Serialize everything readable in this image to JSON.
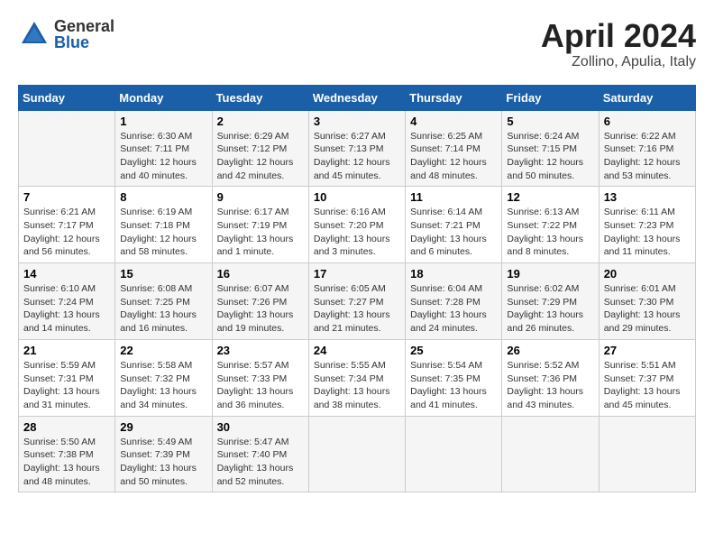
{
  "header": {
    "logo_general": "General",
    "logo_blue": "Blue",
    "month_title": "April 2024",
    "location": "Zollino, Apulia, Italy"
  },
  "weekdays": [
    "Sunday",
    "Monday",
    "Tuesday",
    "Wednesday",
    "Thursday",
    "Friday",
    "Saturday"
  ],
  "weeks": [
    [
      {
        "day": "",
        "info": ""
      },
      {
        "day": "1",
        "info": "Sunrise: 6:30 AM\nSunset: 7:11 PM\nDaylight: 12 hours\nand 40 minutes."
      },
      {
        "day": "2",
        "info": "Sunrise: 6:29 AM\nSunset: 7:12 PM\nDaylight: 12 hours\nand 42 minutes."
      },
      {
        "day": "3",
        "info": "Sunrise: 6:27 AM\nSunset: 7:13 PM\nDaylight: 12 hours\nand 45 minutes."
      },
      {
        "day": "4",
        "info": "Sunrise: 6:25 AM\nSunset: 7:14 PM\nDaylight: 12 hours\nand 48 minutes."
      },
      {
        "day": "5",
        "info": "Sunrise: 6:24 AM\nSunset: 7:15 PM\nDaylight: 12 hours\nand 50 minutes."
      },
      {
        "day": "6",
        "info": "Sunrise: 6:22 AM\nSunset: 7:16 PM\nDaylight: 12 hours\nand 53 minutes."
      }
    ],
    [
      {
        "day": "7",
        "info": "Sunrise: 6:21 AM\nSunset: 7:17 PM\nDaylight: 12 hours\nand 56 minutes."
      },
      {
        "day": "8",
        "info": "Sunrise: 6:19 AM\nSunset: 7:18 PM\nDaylight: 12 hours\nand 58 minutes."
      },
      {
        "day": "9",
        "info": "Sunrise: 6:17 AM\nSunset: 7:19 PM\nDaylight: 13 hours\nand 1 minute."
      },
      {
        "day": "10",
        "info": "Sunrise: 6:16 AM\nSunset: 7:20 PM\nDaylight: 13 hours\nand 3 minutes."
      },
      {
        "day": "11",
        "info": "Sunrise: 6:14 AM\nSunset: 7:21 PM\nDaylight: 13 hours\nand 6 minutes."
      },
      {
        "day": "12",
        "info": "Sunrise: 6:13 AM\nSunset: 7:22 PM\nDaylight: 13 hours\nand 8 minutes."
      },
      {
        "day": "13",
        "info": "Sunrise: 6:11 AM\nSunset: 7:23 PM\nDaylight: 13 hours\nand 11 minutes."
      }
    ],
    [
      {
        "day": "14",
        "info": "Sunrise: 6:10 AM\nSunset: 7:24 PM\nDaylight: 13 hours\nand 14 minutes."
      },
      {
        "day": "15",
        "info": "Sunrise: 6:08 AM\nSunset: 7:25 PM\nDaylight: 13 hours\nand 16 minutes."
      },
      {
        "day": "16",
        "info": "Sunrise: 6:07 AM\nSunset: 7:26 PM\nDaylight: 13 hours\nand 19 minutes."
      },
      {
        "day": "17",
        "info": "Sunrise: 6:05 AM\nSunset: 7:27 PM\nDaylight: 13 hours\nand 21 minutes."
      },
      {
        "day": "18",
        "info": "Sunrise: 6:04 AM\nSunset: 7:28 PM\nDaylight: 13 hours\nand 24 minutes."
      },
      {
        "day": "19",
        "info": "Sunrise: 6:02 AM\nSunset: 7:29 PM\nDaylight: 13 hours\nand 26 minutes."
      },
      {
        "day": "20",
        "info": "Sunrise: 6:01 AM\nSunset: 7:30 PM\nDaylight: 13 hours\nand 29 minutes."
      }
    ],
    [
      {
        "day": "21",
        "info": "Sunrise: 5:59 AM\nSunset: 7:31 PM\nDaylight: 13 hours\nand 31 minutes."
      },
      {
        "day": "22",
        "info": "Sunrise: 5:58 AM\nSunset: 7:32 PM\nDaylight: 13 hours\nand 34 minutes."
      },
      {
        "day": "23",
        "info": "Sunrise: 5:57 AM\nSunset: 7:33 PM\nDaylight: 13 hours\nand 36 minutes."
      },
      {
        "day": "24",
        "info": "Sunrise: 5:55 AM\nSunset: 7:34 PM\nDaylight: 13 hours\nand 38 minutes."
      },
      {
        "day": "25",
        "info": "Sunrise: 5:54 AM\nSunset: 7:35 PM\nDaylight: 13 hours\nand 41 minutes."
      },
      {
        "day": "26",
        "info": "Sunrise: 5:52 AM\nSunset: 7:36 PM\nDaylight: 13 hours\nand 43 minutes."
      },
      {
        "day": "27",
        "info": "Sunrise: 5:51 AM\nSunset: 7:37 PM\nDaylight: 13 hours\nand 45 minutes."
      }
    ],
    [
      {
        "day": "28",
        "info": "Sunrise: 5:50 AM\nSunset: 7:38 PM\nDaylight: 13 hours\nand 48 minutes."
      },
      {
        "day": "29",
        "info": "Sunrise: 5:49 AM\nSunset: 7:39 PM\nDaylight: 13 hours\nand 50 minutes."
      },
      {
        "day": "30",
        "info": "Sunrise: 5:47 AM\nSunset: 7:40 PM\nDaylight: 13 hours\nand 52 minutes."
      },
      {
        "day": "",
        "info": ""
      },
      {
        "day": "",
        "info": ""
      },
      {
        "day": "",
        "info": ""
      },
      {
        "day": "",
        "info": ""
      }
    ]
  ]
}
